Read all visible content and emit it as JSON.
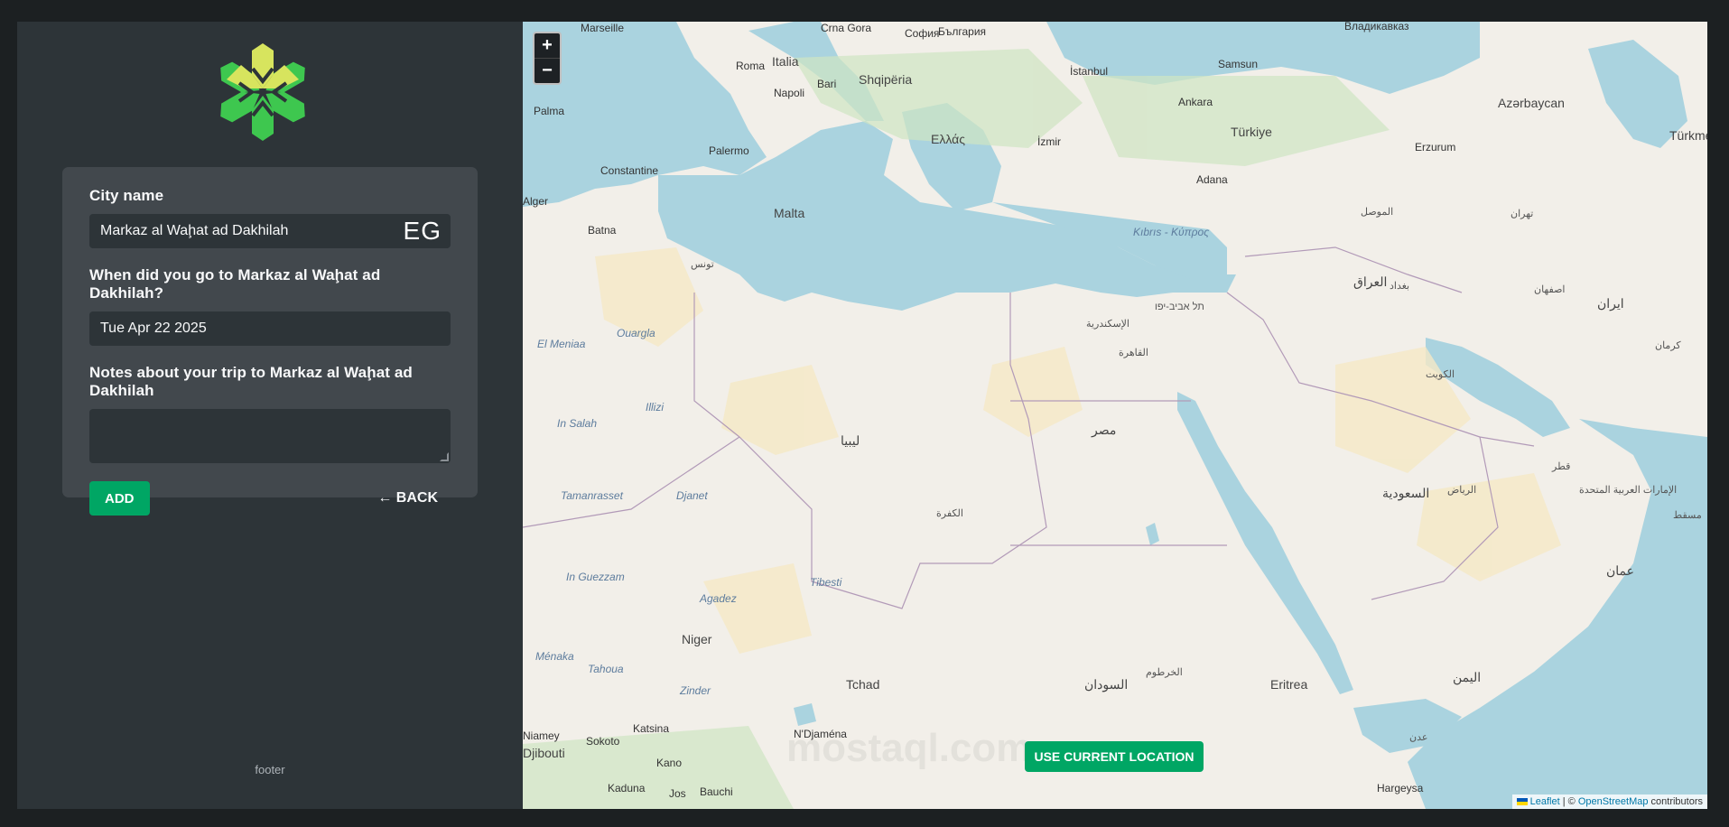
{
  "logo_icon": "asterisk-flower-icon",
  "form": {
    "city_label": "City name",
    "city_value": "Markaz al Waḩat ad Dakhilah",
    "country_code": "EG",
    "date_label": "When did you go to Markaz al Waḩat ad Dakhilah?",
    "date_value": "Tue Apr 22 2025",
    "notes_label": "Notes about your trip to Markaz al Waḩat ad Dakhilah",
    "notes_value": "",
    "add_label": "ADD",
    "back_label": "← BACK"
  },
  "footer": "footer",
  "map": {
    "zoom_in": "+",
    "zoom_out": "−",
    "use_location": "USE CURRENT LOCATION",
    "attribution_leaflet": "Leaflet",
    "attribution_sep": " | © ",
    "attribution_osm": "OpenStreetMap",
    "attribution_tail": " contributors",
    "watermark": "mostaql.com",
    "labels": {
      "marseille": "Marseille",
      "crna_gora": "Crna Gora",
      "bulgaria": "България",
      "sofia": "София",
      "vladikavkaz": "Владикавказ",
      "roma": "Roma",
      "italia": "Italia",
      "bari": "Bari",
      "napoli": "Napoli",
      "shqiperia": "Shqipëria",
      "istanbul": "İstanbul",
      "samsun": "Samsun",
      "ankara": "Ankara",
      "turkiye": "Türkiye",
      "azarbaycan": "Azərbaycan",
      "palma": "Palma",
      "palermo": "Palermo",
      "ellas": "Ελλάς",
      "izmir": "İzmir",
      "erzurum": "Erzurum",
      "malta": "Malta",
      "constantine": "Constantine",
      "alger": "Alger",
      "batna": "Batna",
      "kibris": "Kıbrıs - Κύπρος",
      "adana": "Adana",
      "tunis": "تونس",
      "mosul": "الموصل",
      "iraq": "العراق",
      "iran": "ایران",
      "ouargla": "Ouargla",
      "el_meniaa": "El Meniaa",
      "libya": "ليبيا",
      "cairo": "القاهرة",
      "egypt": "مصر",
      "alexandria": "الإسكندرية",
      "tel_aviv": "תל אביב-יפו",
      "in_salah": "In Salah",
      "illizi": "Illizi",
      "saudi": "السعودية",
      "riyadh": "الرياض",
      "tamanrasset": "Tamanrasset",
      "djanet": "Djanet",
      "kufra": "الكفرة",
      "niger": "Niger",
      "agadez": "Agadez",
      "in_guezzam": "In Guezzam",
      "tibesti": "Tibesti",
      "tchad": "Tchad",
      "sudan": "السودان",
      "khartoum": "الخرطوم",
      "eritrea": "Eritrea",
      "djibouti": "Djibouti",
      "yemen": "اليمن",
      "oman": "عمان",
      "niamey": "Niamey",
      "ndjamena": "N'Djaména",
      "kano": "Kano",
      "zinder": "Zinder",
      "menaka": "Ménaka",
      "tahoua": "Tahoua",
      "katsina": "Katsina",
      "sokoto": "Sokoto",
      "kaduna": "Kaduna",
      "bauchi": "Bauchi",
      "jos": "Jos",
      "hargeysa": "Hargeysa",
      "baghdad": "بغداد",
      "kuwait": "الكويت",
      "tehran": "تهران",
      "isfahan": "اصفهان",
      "kerman": "کرمان",
      "qatar": "قطر",
      "uae": "الإمارات العربية المتحدة",
      "muscat": "مسقط",
      "turkmen": "Türkme",
      "aden": "عدن"
    }
  }
}
